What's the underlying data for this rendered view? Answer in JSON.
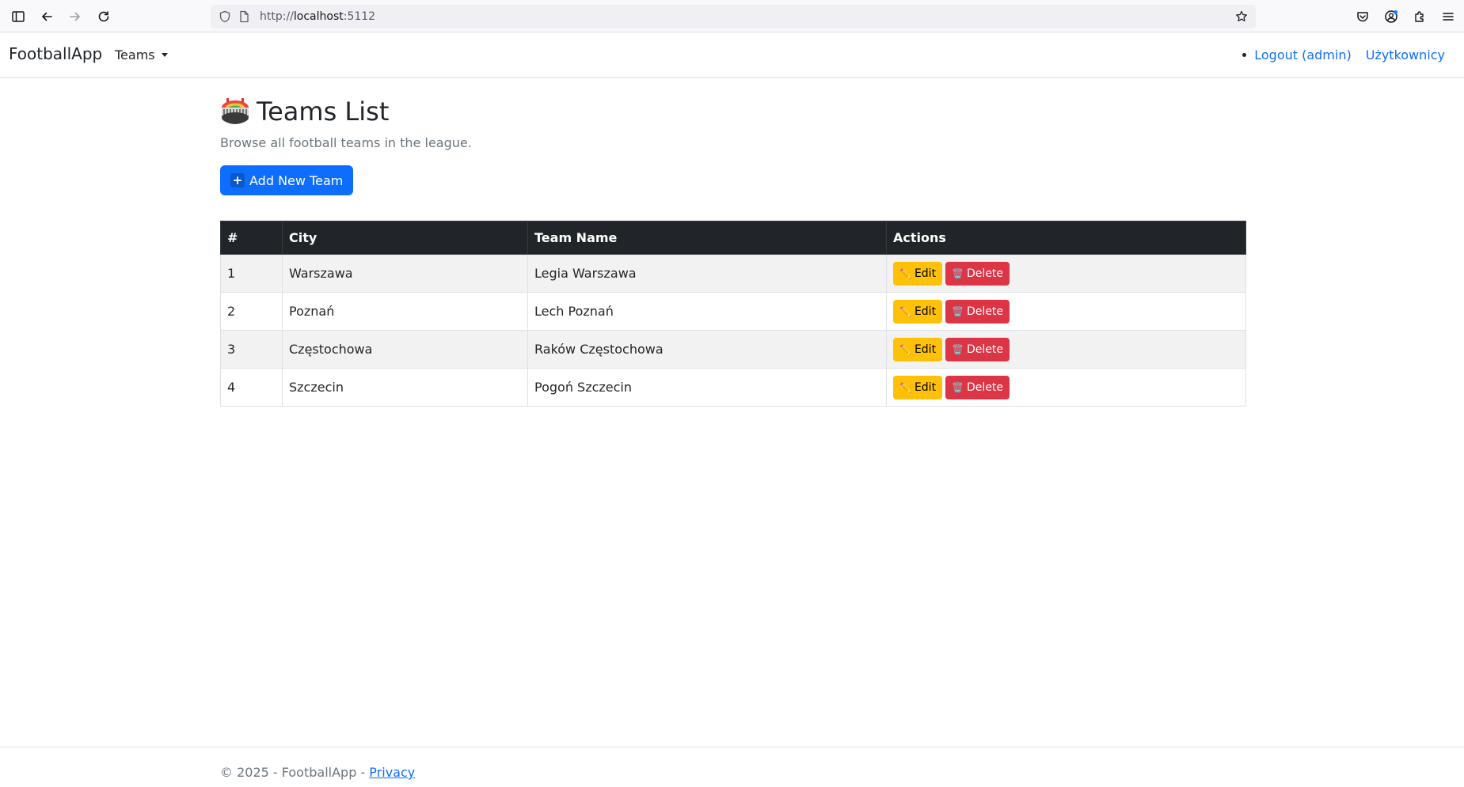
{
  "browser": {
    "url_scheme": "http://",
    "url_host": "localhost",
    "url_port": ":5112"
  },
  "navbar": {
    "brand": "FootballApp",
    "teams_menu": "Teams",
    "logout": "Logout (admin)",
    "users": "Użytkownicy"
  },
  "page": {
    "title": "Teams List",
    "subtitle": "Browse all football teams in the league.",
    "add_button": "Add New Team"
  },
  "table": {
    "headers": [
      "#",
      "City",
      "Team Name",
      "Actions"
    ],
    "rows": [
      {
        "num": "1",
        "city": "Warszawa",
        "team": "Legia Warszawa"
      },
      {
        "num": "2",
        "city": "Poznań",
        "team": "Lech Poznań"
      },
      {
        "num": "3",
        "city": "Częstochowa",
        "team": "Raków Częstochowa"
      },
      {
        "num": "4",
        "city": "Szczecin",
        "team": "Pogoń Szczecin"
      }
    ],
    "edit_label": "Edit",
    "delete_label": "Delete"
  },
  "footer": {
    "copyright": "© 2025 - FootballApp - ",
    "privacy": "Privacy"
  },
  "icons": {
    "title": "stadium-icon",
    "add": "plus-icon",
    "edit": "pencil-icon",
    "delete": "wastebasket-icon"
  },
  "colors": {
    "primary": "#0d6efd",
    "warning": "#ffc107",
    "danger": "#dc3545",
    "table_header": "#212529"
  }
}
